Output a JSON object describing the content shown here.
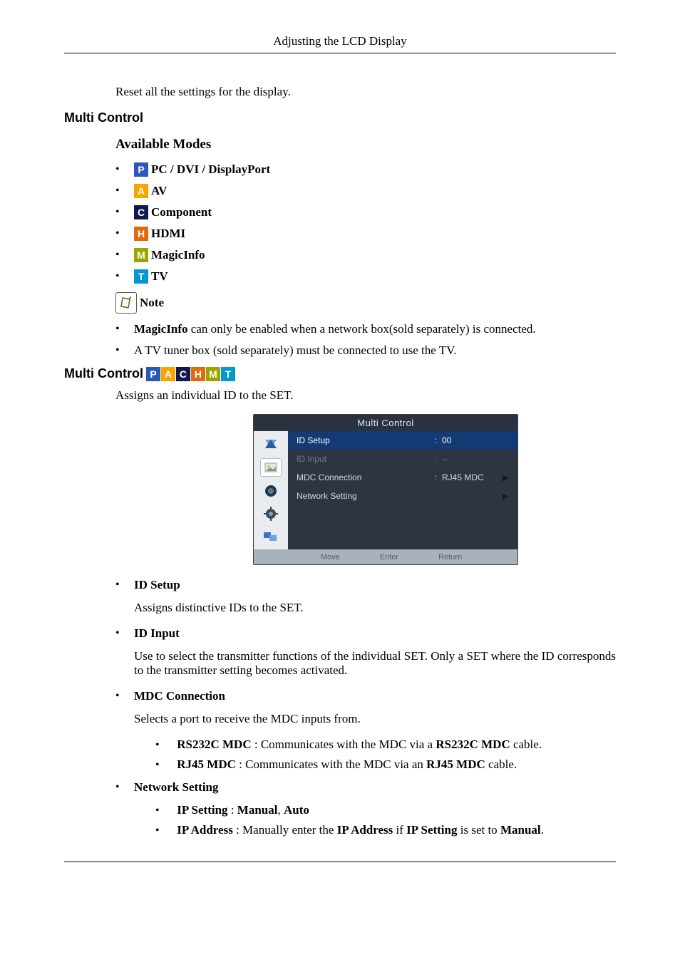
{
  "header": {
    "title": "Adjusting the LCD Display"
  },
  "intro": {
    "reset_text": "Reset all the settings for the display."
  },
  "section_multi_control": {
    "heading": "Multi Control",
    "available_modes_heading": "Available Modes",
    "modes": [
      {
        "code": "P",
        "class": "mi-p",
        "label": "PC / DVI / DisplayPort",
        "name": "mode-pc"
      },
      {
        "code": "A",
        "class": "mi-a",
        "label": "AV",
        "name": "mode-av"
      },
      {
        "code": "C",
        "class": "mi-c",
        "label": "Component",
        "name": "mode-component"
      },
      {
        "code": "H",
        "class": "mi-h",
        "label": "HDMI",
        "name": "mode-hdmi"
      },
      {
        "code": "M",
        "class": "mi-m",
        "label": "MagicInfo",
        "name": "mode-magicinfo"
      },
      {
        "code": "T",
        "class": "mi-t",
        "label": "TV",
        "name": "mode-tv"
      }
    ],
    "note_label": "Note",
    "notes": [
      {
        "bold": "MagicInfo",
        "rest": " can only be enabled when a network box(sold separately) is connected."
      },
      {
        "bold": "",
        "rest": "A TV tuner box (sold separately) must be connected to use the TV."
      }
    ]
  },
  "section_multi_control_detail": {
    "heading": "Multi Control",
    "desc": "Assigns an individual ID to the SET.",
    "osd": {
      "title": "Multi Control",
      "rows": [
        {
          "label": "ID Setup",
          "value": "00",
          "selected": true,
          "has_arrow": false
        },
        {
          "label": "ID Input",
          "value": "--",
          "dim": true,
          "has_arrow": false
        },
        {
          "label": "MDC Connection",
          "value": "RJ45 MDC",
          "has_arrow": true
        },
        {
          "label": "Network Setting",
          "value": "",
          "has_arrow": true
        }
      ],
      "footer": {
        "move": "Move",
        "enter": "Enter",
        "return": "Return"
      }
    },
    "items": {
      "id_setup": {
        "label": "ID Setup",
        "desc": "Assigns distinctive IDs to the SET."
      },
      "id_input": {
        "label": "ID Input",
        "desc": "Use to select the transmitter functions of the individual SET. Only a SET where the ID corresponds to the transmitter setting becomes activated."
      },
      "mdc": {
        "label": "MDC Connection",
        "desc": "Selects a port to receive the MDC inputs from.",
        "opt_rs232c_pre": "RS232C MDC",
        "opt_rs232c_mid": " : Communicates with the MDC via a ",
        "opt_rs232c_bold2": "RS232C MDC",
        "opt_rs232c_end": " cable.",
        "opt_rj45_pre": "RJ45 MDC",
        "opt_rj45_mid": " : Communicates with the MDC via an ",
        "opt_rj45_bold2": "RJ45 MDC",
        "opt_rj45_end": " cable."
      },
      "network": {
        "label": "Network Setting",
        "ip_setting_label": "IP Setting",
        "ip_setting_sep": " : ",
        "ip_setting_v1": "Manual",
        "ip_setting_comma": ", ",
        "ip_setting_v2": "Auto",
        "ip_address_label": "IP Address",
        "ip_address_t1": " : Manually enter the ",
        "ip_address_b1": "IP Address",
        "ip_address_t2": " if ",
        "ip_address_b2": "IP Setting",
        "ip_address_t3": " is set to ",
        "ip_address_b3": "Manual",
        "ip_address_t4": "."
      }
    }
  }
}
